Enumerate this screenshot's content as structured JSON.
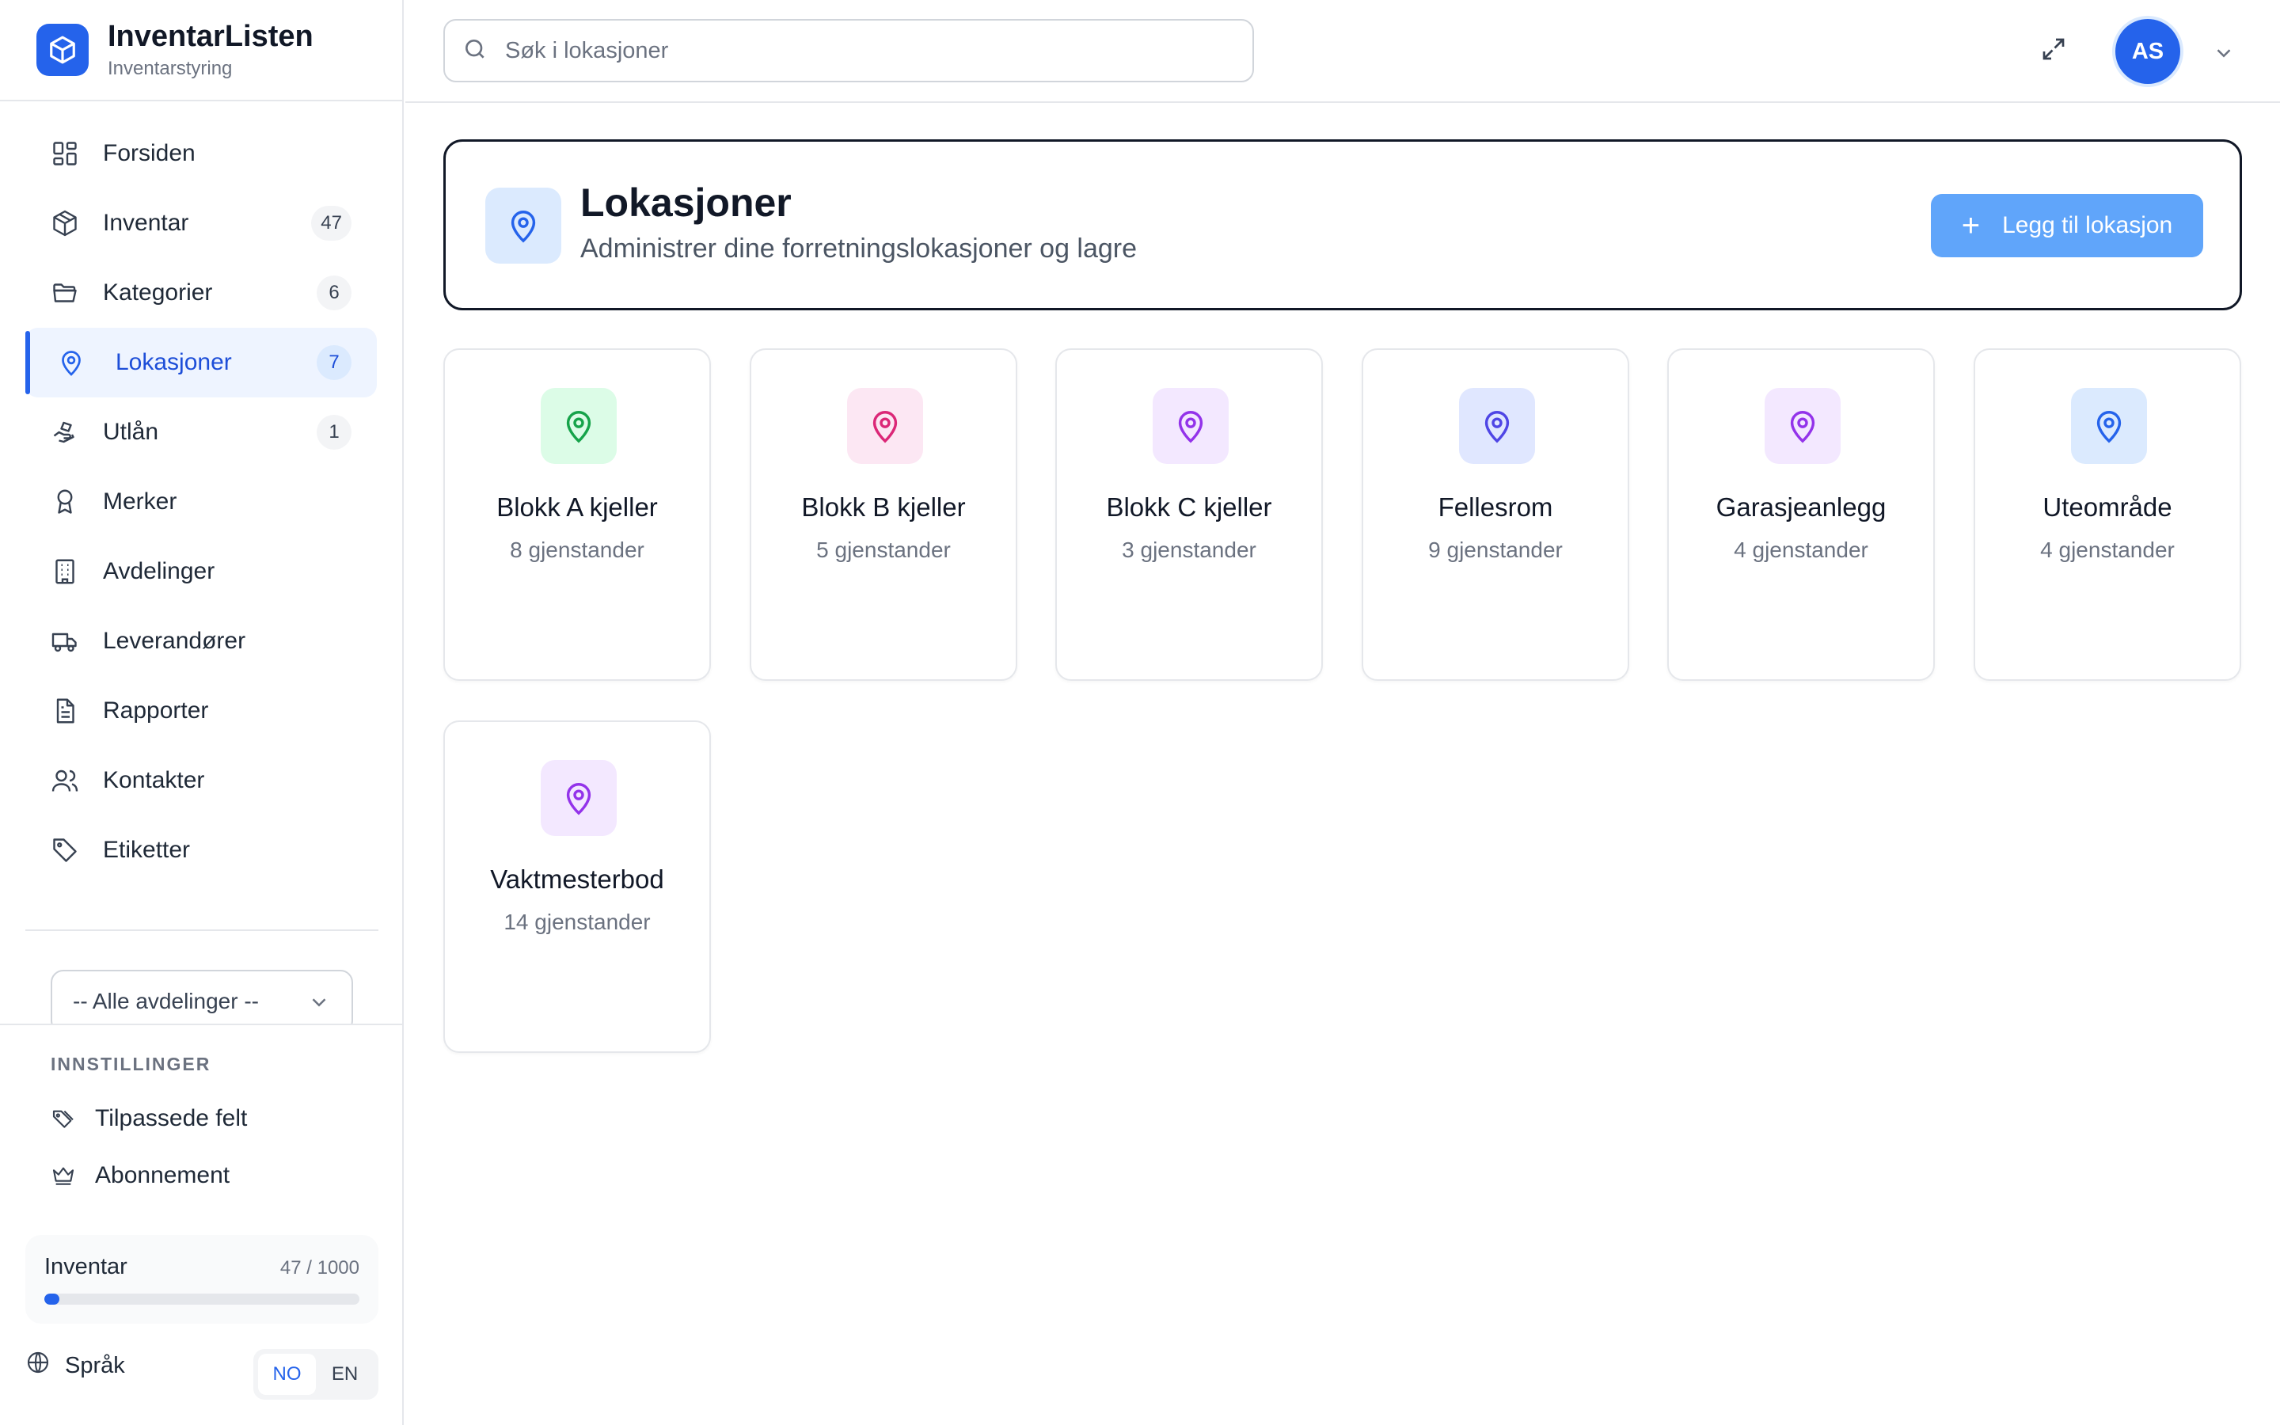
{
  "brand": {
    "title": "InventarListen",
    "subtitle": "Inventarstyring"
  },
  "nav": [
    {
      "label": "Forsiden",
      "icon": "grid-icon"
    },
    {
      "label": "Inventar",
      "icon": "box-icon",
      "badge": "47"
    },
    {
      "label": "Kategorier",
      "icon": "folder-icon",
      "badge": "6"
    },
    {
      "label": "Lokasjoner",
      "icon": "map-pin-icon",
      "badge": "7",
      "active": true
    },
    {
      "label": "Utlån",
      "icon": "hand-icon",
      "badge": "1"
    },
    {
      "label": "Merker",
      "icon": "award-icon"
    },
    {
      "label": "Avdelinger",
      "icon": "building-icon"
    },
    {
      "label": "Leverandører",
      "icon": "truck-icon"
    },
    {
      "label": "Rapporter",
      "icon": "file-text-icon"
    },
    {
      "label": "Kontakter",
      "icon": "users-icon"
    },
    {
      "label": "Etiketter",
      "icon": "tag-icon"
    }
  ],
  "department_select": {
    "value": "-- Alle avdelinger --"
  },
  "settings": {
    "title": "INNSTILLINGER",
    "items": [
      {
        "label": "Tilpassede felt",
        "icon": "tags-icon"
      },
      {
        "label": "Abonnement",
        "icon": "crown-icon"
      }
    ]
  },
  "usage": {
    "label": "Inventar",
    "count": "47 / 1000",
    "fraction": 0.047
  },
  "language": {
    "label": "Språk",
    "options": [
      "NO",
      "EN"
    ],
    "selected": "NO"
  },
  "search": {
    "placeholder": "Søk i lokasjoner"
  },
  "user": {
    "initials": "AS"
  },
  "page": {
    "title": "Lokasjoner",
    "subtitle": "Administrer dine forretningslokasjoner og lagre",
    "add_button": "Legg til lokasjon"
  },
  "locations": [
    {
      "name": "Blokk A kjeller",
      "count": "8 gjenstander",
      "bg": "#dcfce7",
      "fg": "#16a34a"
    },
    {
      "name": "Blokk B kjeller",
      "count": "5 gjenstander",
      "bg": "#fce7f3",
      "fg": "#db2777"
    },
    {
      "name": "Blokk C kjeller",
      "count": "3 gjenstander",
      "bg": "#f3e8ff",
      "fg": "#9333ea"
    },
    {
      "name": "Fellesrom",
      "count": "9 gjenstander",
      "bg": "#e0e7ff",
      "fg": "#4f46e5"
    },
    {
      "name": "Garasjeanlegg",
      "count": "4 gjenstander",
      "bg": "#f3e8ff",
      "fg": "#9333ea"
    },
    {
      "name": "Uteområde",
      "count": "4 gjenstander",
      "bg": "#dbeafe",
      "fg": "#2563eb"
    },
    {
      "name": "Vaktmesterbod",
      "count": "14 gjenstander",
      "bg": "#f3e8ff",
      "fg": "#9333ea"
    }
  ],
  "colors": {
    "accent": "#2563eb",
    "accent_light": "#60a5fa"
  }
}
